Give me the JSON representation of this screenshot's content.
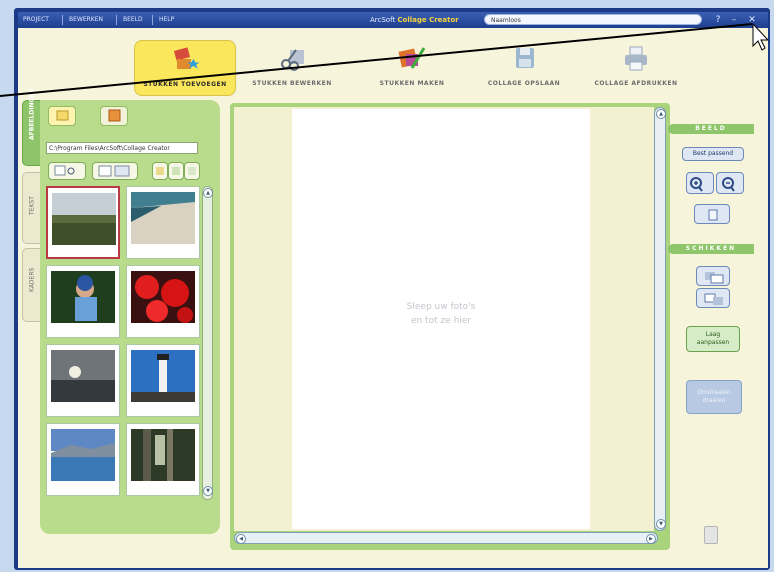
{
  "window": {
    "menu": [
      "PROJECT",
      "BEWERKEN",
      "BEELD",
      "HELP"
    ],
    "title_prefix": "ArcSoft",
    "title_product": "Collage Creator",
    "quick_search_value": "Naamloos",
    "help_label": "?",
    "minimize_label": "–",
    "close_label": "✕"
  },
  "toolbar": {
    "tools": [
      {
        "label": "STUKKEN TOEVOEGEN",
        "icon": "add-pieces-icon",
        "active": true
      },
      {
        "label": "STUKKEN BEWERKEN",
        "icon": "edit-pieces-icon",
        "active": false
      },
      {
        "label": "STUKKEN MAKEN",
        "icon": "make-pieces-icon",
        "active": false
      },
      {
        "label": "COLLAGE OPSLAAN",
        "icon": "save-collage-icon",
        "active": false
      },
      {
        "label": "COLLAGE AFDRUKKEN",
        "icon": "print-collage-icon",
        "active": false
      }
    ]
  },
  "left_panel": {
    "tabs": [
      "AFBEELDINGEN",
      "TEKST",
      "KADERS"
    ],
    "path": "C:\\Program Files\\ArcSoft\\Collage Creator",
    "thumbnails": [
      {
        "icon": "landscape-photo",
        "selected": true
      },
      {
        "icon": "beach-photo",
        "selected": false
      },
      {
        "icon": "child-photo",
        "selected": false
      },
      {
        "icon": "red-flowers-photo",
        "selected": false
      },
      {
        "icon": "sunset-photo",
        "selected": false
      },
      {
        "icon": "lighthouse-photo",
        "selected": false
      },
      {
        "icon": "mountain-lake-photo",
        "selected": false
      },
      {
        "icon": "forest-photo",
        "selected": false
      }
    ]
  },
  "canvas": {
    "drop_hint_line1": "Sleep uw foto's",
    "drop_hint_line2": "en tot ze hier"
  },
  "right_panel": {
    "section1_title": "BEELD",
    "fit_button": "Best passend",
    "section2_title": "SCHIKKEN",
    "layer_button_line1": "Laag",
    "layer_button_line2": "aanpassen",
    "disabled_button_line1": "Omdraaien",
    "disabled_button_line2": "draaien"
  },
  "colors": {
    "accent_green": "#8fc56a",
    "title_blue": "#1f3f8f",
    "product_yellow": "#f5d33a"
  }
}
